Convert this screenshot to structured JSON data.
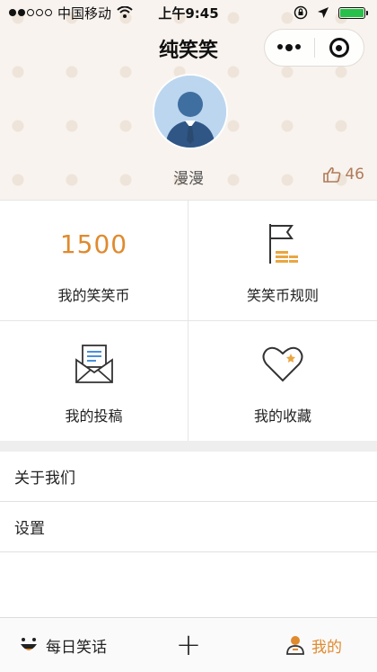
{
  "status": {
    "carrier": "中国移动",
    "time": "上午9:45"
  },
  "header": {
    "title": "纯笑笑",
    "username": "漫漫",
    "likes": "46"
  },
  "grid": {
    "coins_value": "1500",
    "my_coins_label": "我的笑笑币",
    "coin_rules_label": "笑笑币规则",
    "my_posts_label": "我的投稿",
    "my_favorites_label": "我的收藏"
  },
  "menu": {
    "about_label": "关于我们",
    "settings_label": "设置"
  },
  "tabbar": {
    "daily_jokes_label": "每日笑话",
    "mine_label": "我的"
  },
  "colors": {
    "accent": "#e08a2e",
    "header_bg": "#f8f3ee"
  }
}
